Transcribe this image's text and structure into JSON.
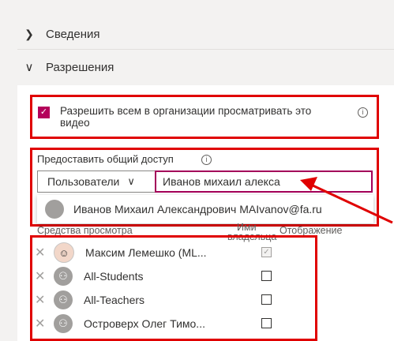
{
  "sections": {
    "details_label": "Сведения",
    "permissions_label": "Разрешения"
  },
  "allow_org_view": {
    "checked": true,
    "line1": "Разрешить всем в организации просматривать это",
    "line2": "видео"
  },
  "share": {
    "label": "Предоставить общий доступ",
    "scope_value": "Пользователи",
    "search_value": "Иванов михаил алекса",
    "suggestion": "Иванов Михаил Александрович MAIvanov@fa.ru"
  },
  "table": {
    "col_viewers": "Средства просмотра",
    "col_owner_line1": "Ими",
    "col_owner_line2": "владельца",
    "col_display": "Отображение",
    "rows": [
      {
        "name": "Максим Лемешко (ML...",
        "owner_checked": true,
        "owner_disabled": true
      },
      {
        "name": "All-Students",
        "owner_checked": false
      },
      {
        "name": "All-Teachers",
        "owner_checked": false
      },
      {
        "name": "Островерх Олег Тимо...",
        "owner_checked": false
      }
    ]
  },
  "colors": {
    "accent": "#b4005a",
    "highlight_red": "#e00000"
  }
}
